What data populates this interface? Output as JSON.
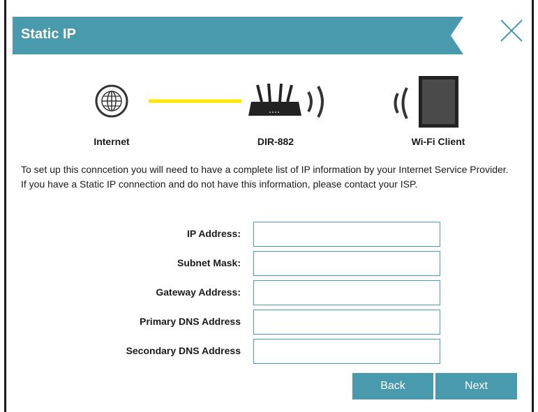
{
  "dialog": {
    "title": "Static IP",
    "close_icon": "close-icon",
    "accent_color": "#4a9aad",
    "link_color": "#ffe600"
  },
  "diagram": {
    "nodes": [
      {
        "label": "Internet",
        "icon": "globe-icon"
      },
      {
        "label": "DIR-882",
        "icon": "router-icon"
      },
      {
        "label": "Wi-Fi Client",
        "icon": "tablet-icon"
      }
    ]
  },
  "description": "To set up this conncetion you will need to have a complete list of IP information by your Internet Service Provider. If you have a Static IP connection and do not have this information, please contact your ISP.",
  "form": {
    "fields": [
      {
        "label": "IP Address:",
        "value": "",
        "placeholder": ""
      },
      {
        "label": "Subnet Mask:",
        "value": "",
        "placeholder": ""
      },
      {
        "label": "Gateway Address:",
        "value": "",
        "placeholder": ""
      },
      {
        "label": "Primary DNS Address",
        "value": "",
        "placeholder": ""
      },
      {
        "label": "Secondary DNS Address",
        "value": "",
        "placeholder": ""
      }
    ]
  },
  "buttons": {
    "back": "Back",
    "next": "Next"
  }
}
